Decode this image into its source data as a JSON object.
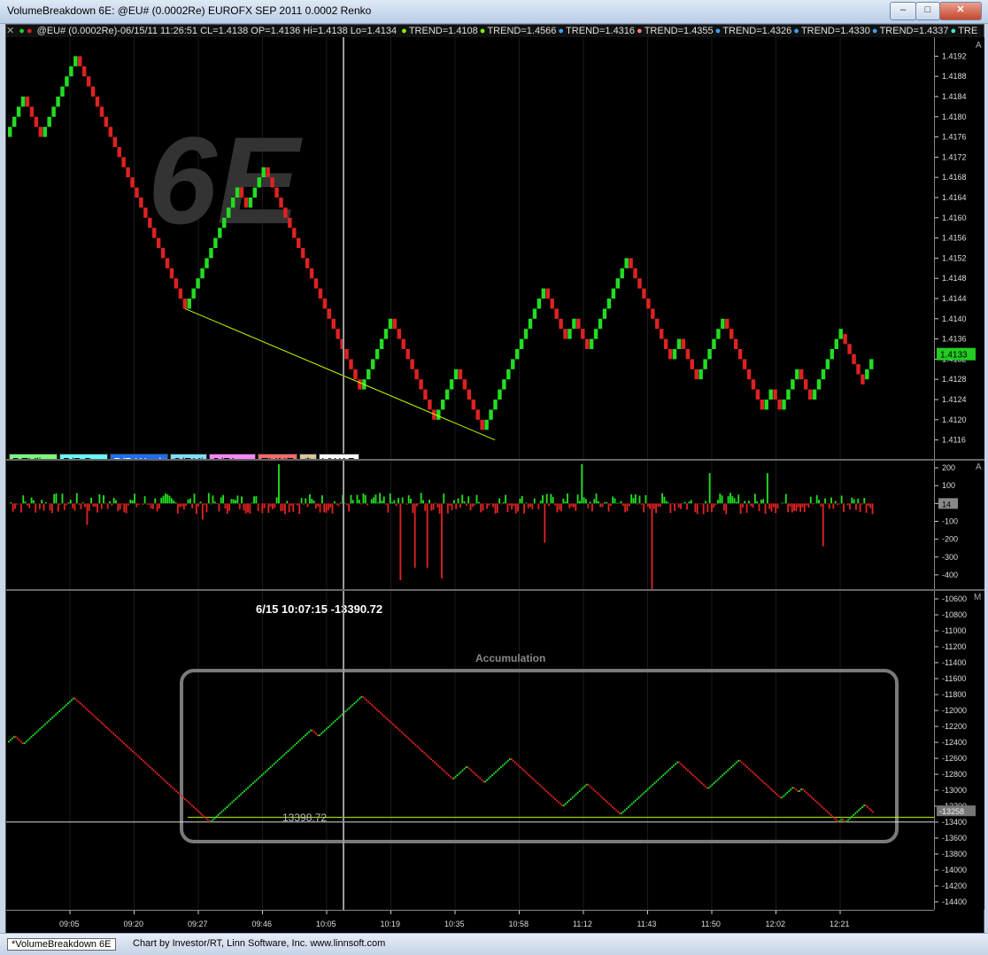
{
  "window": {
    "title": "VolumeBreakdown 6E: @EU# (0.0002Re) EUROFX SEP 2011 0.0002 Renko",
    "min": "–",
    "max": "□",
    "close": "✕"
  },
  "legend": {
    "close_x": "✕",
    "quote": "@EU# (0.0002Re)-06/15/11 11:26:51 CL=1.4138 OP=1.4136 Hi=1.4138 Lo=1.4134",
    "trends": [
      {
        "text": "TREND=1.4108",
        "color": "#7CFC00"
      },
      {
        "text": "TREND=1.4566",
        "color": "#7CFC00"
      },
      {
        "text": "TREND=1.4316",
        "color": "#3fa0ff"
      },
      {
        "text": "TREND=1.4355",
        "color": "#ff7b7b"
      },
      {
        "text": "TREND=1.4326",
        "color": "#3fa0ff"
      },
      {
        "text": "TREND=1.4330",
        "color": "#3fa0ff"
      },
      {
        "text": "TREND=1.4337",
        "color": "#3fa0ff"
      },
      {
        "text": "TRE",
        "color": "#40e0d0"
      }
    ]
  },
  "watermark": "6E",
  "toolbar": [
    {
      "label": "DEVline",
      "bg": "#7CFC7C"
    },
    {
      "label": "P/P Day",
      "bg": "#66ffff"
    },
    {
      "label": "P/P Week",
      "bg": "#1e6fff"
    },
    {
      "label": "S/RHi",
      "bg": "#7fe0ff"
    },
    {
      "label": "S/RLow",
      "bg": "#ff88ff"
    },
    {
      "label": "TLINE",
      "bg": "#ff6b6b"
    },
    {
      "label": "⚙",
      "bg": "#d8c8a0"
    },
    {
      "label": "VWAP",
      "bg": "#ffffff"
    }
  ],
  "panel_markers": {
    "price": "A",
    "vol": "A",
    "acc": "M"
  },
  "crosshair_readout": "6/15 10:07:15  -13390.72",
  "accumulation_label": "Accumulation",
  "low_label": "13398.72",
  "chart_data": [
    {
      "type": "renko",
      "name": "price",
      "ylim": [
        1.4114,
        1.4194
      ],
      "yticks": [
        1.4192,
        1.4188,
        1.4184,
        1.418,
        1.4176,
        1.4172,
        1.4168,
        1.4164,
        1.416,
        1.4156,
        1.4152,
        1.4148,
        1.4144,
        1.414,
        1.4136,
        1.4132,
        1.4128,
        1.4124,
        1.412,
        1.4116
      ],
      "last_price": "1.4133",
      "path": [
        1.4176,
        1.4184,
        1.4176,
        1.4186,
        1.4192,
        1.4178,
        1.4166,
        1.4156,
        1.4142,
        1.416,
        1.4166,
        1.4162,
        1.417,
        1.4156,
        1.415,
        1.4134,
        1.4126,
        1.414,
        1.4122,
        1.412,
        1.413,
        1.4118,
        1.413,
        1.4146,
        1.4136,
        1.414,
        1.4134,
        1.4152,
        1.414,
        1.4132,
        1.4136,
        1.4128,
        1.414,
        1.4128,
        1.4122,
        1.4126,
        1.4122,
        1.413,
        1.4124,
        1.4137,
        1.4128,
        1.4132
      ]
    },
    {
      "type": "bar",
      "name": "volume-delta",
      "ylim": [
        -480,
        240
      ],
      "yticks": [
        200,
        100,
        0,
        -100,
        -200,
        -300,
        -400
      ],
      "zero_badge": "14",
      "n": 420,
      "spikes": [
        [
          38,
          -120
        ],
        [
          94,
          -90
        ],
        [
          131,
          220
        ],
        [
          190,
          -430
        ],
        [
          197,
          -360
        ],
        [
          203,
          -360
        ],
        [
          210,
          -420
        ],
        [
          260,
          -220
        ],
        [
          278,
          220
        ],
        [
          312,
          -500
        ],
        [
          340,
          170
        ],
        [
          368,
          170
        ],
        [
          395,
          -240
        ],
        [
          437,
          -460
        ],
        [
          440,
          170
        ],
        [
          470,
          -130
        ]
      ]
    },
    {
      "type": "renko",
      "name": "accumulation",
      "ylim": [
        -14500,
        -10500
      ],
      "yticks": [
        -10600,
        -10800,
        -11000,
        -11200,
        -11400,
        -11600,
        -11800,
        -12000,
        -12200,
        -12400,
        -12600,
        -12800,
        -13000,
        -13200,
        -13400,
        -13600,
        -13800,
        -14000,
        -14200,
        -14400
      ],
      "last_value": "-13258",
      "path": [
        -12400,
        -12320,
        -12420,
        -12300,
        -11840,
        -11940,
        -12260,
        -12560,
        -12700,
        -13400,
        -12840,
        -12360,
        -12240,
        -12320,
        -12180,
        -11820,
        -11940,
        -12220,
        -12300,
        -12380,
        -12860,
        -12700,
        -12900,
        -12600,
        -12760,
        -13200,
        -13120,
        -12920,
        -13300,
        -13080,
        -12860,
        -12640,
        -12700,
        -12980,
        -12620,
        -12920,
        -12980,
        -13100,
        -12960,
        -13020,
        -12980,
        -13300,
        -13400,
        -13360,
        -13400,
        -13180,
        -13280
      ]
    }
  ],
  "x_labels": [
    "09:05",
    "09:20",
    "09:27",
    "09:46",
    "10:05",
    "10:19",
    "10:35",
    "10:58",
    "11:12",
    "11:43",
    "11:50",
    "12:02",
    "12:21"
  ],
  "status": {
    "tab": "*VolumeBreakdown 6E",
    "credit": "Chart by Investor/RT, Linn Software, Inc. www.linnsoft.com"
  },
  "colors": {
    "up": "#22dd22",
    "down": "#dd2222",
    "trendline": "#bfff00",
    "crosshair": "#9a9a9a",
    "accbox": "#7a7a7a"
  }
}
